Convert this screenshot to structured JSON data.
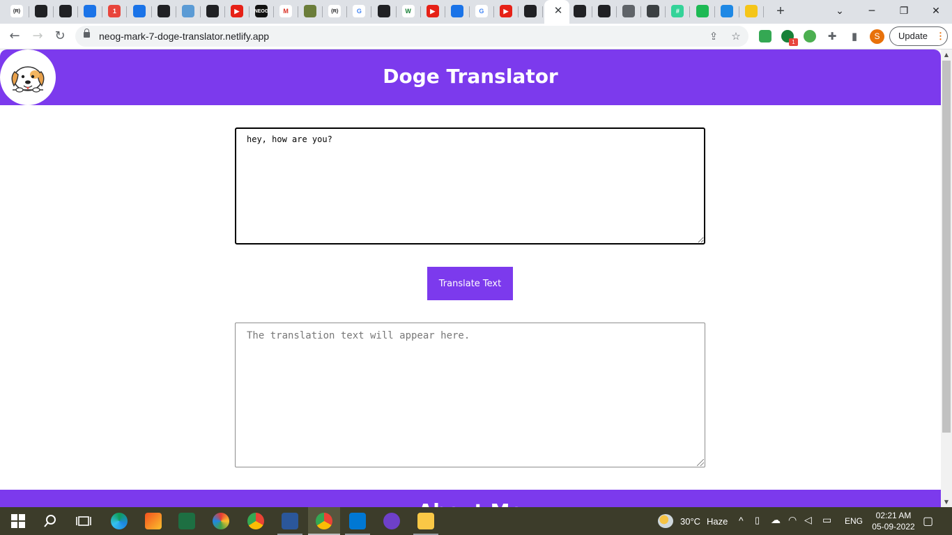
{
  "browser": {
    "active_tab_close": "✕",
    "new_tab": "+",
    "tab_favicons": [
      {
        "icon": "r-brackets-icon",
        "text": "{R}",
        "color": "#ffffff",
        "fg": "#202124"
      },
      {
        "icon": "github-icon",
        "text": "",
        "color": "#202124"
      },
      {
        "icon": "github-icon",
        "text": "",
        "color": "#202124"
      },
      {
        "icon": "power-icon",
        "text": "",
        "color": "#1a73e8"
      },
      {
        "icon": "badge-1-icon",
        "text": "1",
        "color": "#e8453c"
      },
      {
        "icon": "diamond-icon",
        "text": "",
        "color": "#1a73e8"
      },
      {
        "icon": "github-icon",
        "text": "",
        "color": "#202124"
      },
      {
        "icon": "laptop-icon",
        "text": "",
        "color": "#5b9bd5"
      },
      {
        "icon": "github-icon",
        "text": "",
        "color": "#202124"
      },
      {
        "icon": "youtube-icon",
        "text": "▶",
        "color": "#e62117"
      },
      {
        "icon": "neog-icon",
        "text": "NEOG",
        "color": "#111111"
      },
      {
        "icon": "gmail-icon",
        "text": "M",
        "color": "#ffffff",
        "fg": "#d93025"
      },
      {
        "icon": "pixel-icon",
        "text": "",
        "color": "#6b7d3a"
      },
      {
        "icon": "r-brackets-icon",
        "text": "{R}",
        "color": "#ffffff",
        "fg": "#202124"
      },
      {
        "icon": "google-icon",
        "text": "G",
        "color": "#ffffff",
        "fg": "#4285f4"
      },
      {
        "icon": "github-icon",
        "text": "",
        "color": "#202124"
      },
      {
        "icon": "w-icon",
        "text": "W",
        "color": "#ffffff",
        "fg": "#188038"
      },
      {
        "icon": "youtube-icon",
        "text": "▶",
        "color": "#e62117"
      },
      {
        "icon": "spinner-icon",
        "text": "",
        "color": "#1a73e8"
      },
      {
        "icon": "google-icon",
        "text": "G",
        "color": "#ffffff",
        "fg": "#4285f4"
      },
      {
        "icon": "youtube-icon",
        "text": "▶",
        "color": "#e62117"
      },
      {
        "icon": "github-icon",
        "text": "",
        "color": "#202124"
      }
    ],
    "tab_favicons_right": [
      {
        "icon": "wheel-icon",
        "text": "",
        "color": "#202124"
      },
      {
        "icon": "github-icon",
        "text": "",
        "color": "#202124"
      },
      {
        "icon": "globe-icon",
        "text": "",
        "color": "#5f6368"
      },
      {
        "icon": "document-icon",
        "text": "",
        "color": "#3c4043"
      },
      {
        "icon": "hash-icon",
        "text": "#",
        "color": "#34d399"
      },
      {
        "icon": "spotify-icon",
        "text": "",
        "color": "#1db954"
      },
      {
        "icon": "earth-icon",
        "text": "",
        "color": "#1e88e5"
      },
      {
        "icon": "imdb-icon",
        "text": "",
        "color": "#f5c518"
      }
    ],
    "url": "neog-mark-7-doge-translator.netlify.app",
    "extension_badge": "1",
    "profile_initial": "S",
    "update_label": "Update"
  },
  "page": {
    "title": "Doge Translator",
    "input_value": "hey, how are you?",
    "translate_label": "Translate Text",
    "output_placeholder": "The translation text will appear here.",
    "footer_title": "About Me",
    "accent_color": "#7c3aed"
  },
  "taskbar": {
    "weather_temp": "30°C",
    "weather_desc": "Haze",
    "language": "ENG",
    "time": "02:21 AM",
    "date": "05-09-2022"
  }
}
